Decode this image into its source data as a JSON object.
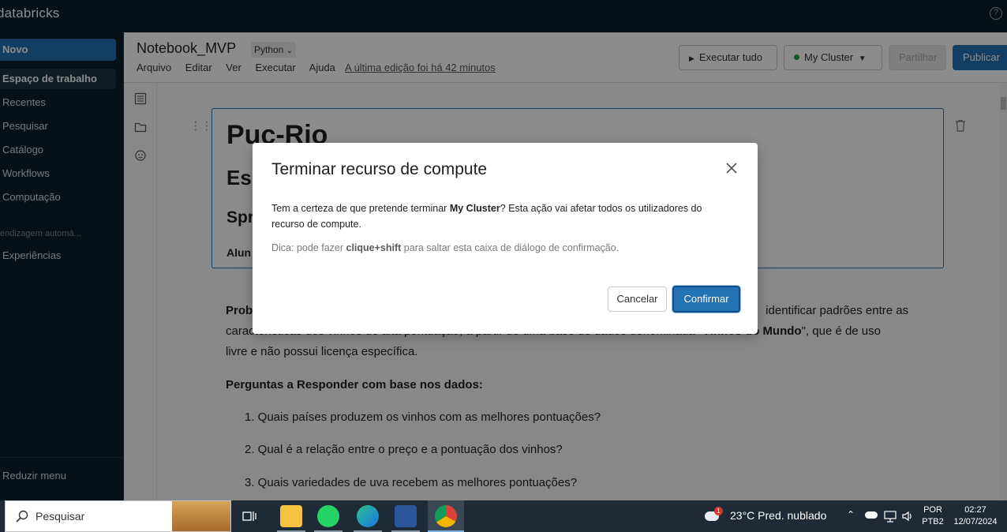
{
  "app": {
    "brand": "databricks"
  },
  "sidebar": {
    "new_label": "Novo",
    "items": [
      {
        "label": "Espaço de trabalho",
        "active": true
      },
      {
        "label": "Recentes"
      },
      {
        "label": "Pesquisar"
      },
      {
        "label": "Catálogo"
      },
      {
        "label": "Workflows"
      },
      {
        "label": "Computação"
      }
    ],
    "section_label": "endizagem automá...",
    "section_items": [
      {
        "label": "Experiências"
      }
    ],
    "collapse_label": "Reduzir menu"
  },
  "notebook": {
    "title": "Notebook_MVP",
    "language": "Python",
    "menu": [
      "Arquivo",
      "Editar",
      "Ver",
      "Executar",
      "Ajuda"
    ],
    "last_edit": "A última edição foi há 42 minutos",
    "run_all_label": "Executar tudo",
    "cluster_label": "My Cluster",
    "share_label": "Partilhar",
    "publish_label": "Publicar"
  },
  "cell": {
    "h1": "Puc-Rio",
    "h2": "Esp",
    "h3": "Spr",
    "h4": "Alun"
  },
  "markdown": {
    "problem_prefix": "Prob",
    "problem_line1_tail": "identificar padrões entre as",
    "problem_line2": "características dos vinhos de alta pontuação, a partir de uma base de dados denominada \"",
    "problem_bold": "Vinhos do Mundo",
    "problem_line2_tail": "\", que é de uso",
    "problem_line3": "livre e não possui licença específica.",
    "questions_heading": "Perguntas a Responder com base nos dados:",
    "questions": [
      "1. Quais países produzem os vinhos com as melhores pontuações?",
      "2. Qual é a relação entre o preço e a pontuação dos vinhos?",
      "3. Quais variedades de uva recebem as melhores pontuações?"
    ]
  },
  "modal": {
    "title": "Terminar recurso de compute",
    "body_prefix": "Tem a certeza de que pretende terminar ",
    "body_cluster": "My Cluster",
    "body_suffix": "? Esta ação vai afetar todos os utilizadores do recurso de compute.",
    "hint_prefix": "Dica: pode fazer ",
    "hint_bold": "clique+shift",
    "hint_suffix": " para saltar esta caixa de diálogo de confirmação.",
    "cancel_label": "Cancelar",
    "confirm_label": "Confirmar"
  },
  "taskbar": {
    "search_placeholder": "Pesquisar",
    "weather": "23°C  Pred. nublado",
    "weather_badge": "1",
    "lang_top": "POR",
    "lang_bottom": "PTB2",
    "time": "02:27",
    "date": "12/07/2024"
  },
  "colors": {
    "accent": "#2272b4",
    "sidebar_bg": "#0b1f2a",
    "cluster_status": "#2e9a4a"
  }
}
